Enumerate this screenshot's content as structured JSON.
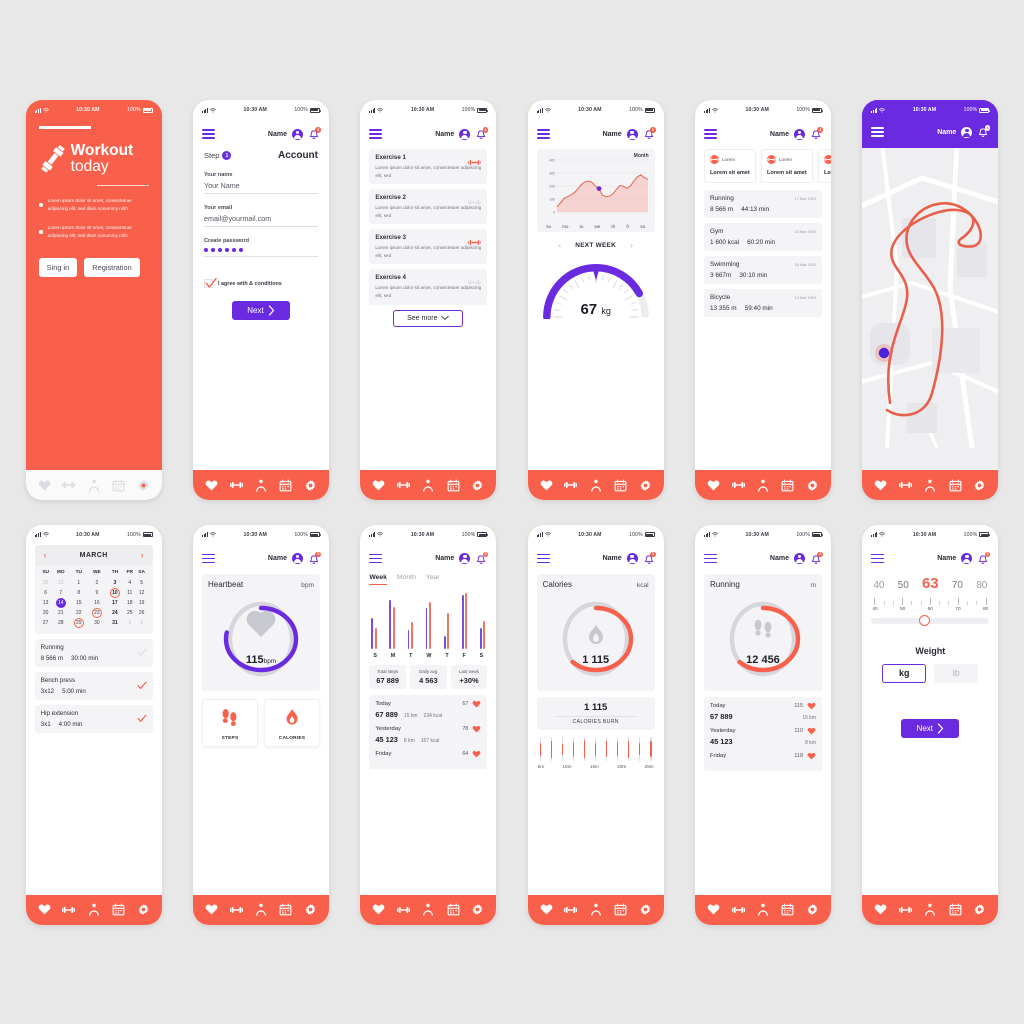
{
  "theme": {
    "red": "#f9604b",
    "purple": "#6a2ae0",
    "bar_purple": "#7b4ce0",
    "bar_red": "#ea7a68",
    "grey_track": "#cfcfd6"
  },
  "statusbar": {
    "time": "10:30 AM",
    "battery": "100%"
  },
  "nav": {
    "items": [
      "heart-icon",
      "dumbbell-icon",
      "person-icon",
      "calendar-icon",
      "gear-icon"
    ]
  },
  "header": {
    "name": "Name",
    "badge": "3"
  },
  "screens": {
    "onboarding": {
      "title_bold": "Workout",
      "title_light": "today",
      "bullets": [
        "Lorem ipsum dolor sit amet, consectetuer adipiscing elit, sed diam nonummy nibh",
        "Lorem ipsum dolor sit amet, consectetuer adipiscing elit, sed diam nonummy nibh"
      ],
      "signin": "Sing in",
      "registration": "Registration"
    },
    "account": {
      "step_label": "Step",
      "step_number": "1",
      "title": "Account",
      "fields": [
        {
          "label": "Your name",
          "value": "Your Name"
        },
        {
          "label": "Your email",
          "value": "email@yourmail.com"
        },
        {
          "label": "Create password",
          "value": "••••••"
        }
      ],
      "agree": "I agree with & conditions",
      "next": "Next"
    },
    "exercises": {
      "items": [
        {
          "title": "Exercise 1",
          "desc": "Lorem ipsum dolor sit amet, consectetuer adipiscing elit, sed",
          "active": true
        },
        {
          "title": "Exercise 2",
          "desc": "Lorem ipsum dolor sit amet, consectetuer adipiscing elit, sed",
          "active": false
        },
        {
          "title": "Exercise 3",
          "desc": "Lorem ipsum dolor sit amet, consectetuer adipiscing elit, sed",
          "active": true
        },
        {
          "title": "Exercise 4",
          "desc": "Lorem ipsum dolor sit amet, consectetuer adipiscing elit, sed",
          "active": false
        }
      ],
      "see_more": "See more"
    },
    "progress": {
      "period": "Month",
      "next_week": "NEXT WEEK",
      "weight_value": "67",
      "weight_unit": "kg"
    },
    "activity": {
      "cards": [
        {
          "tag": "Lorem",
          "body": "Lorem sit amet"
        },
        {
          "tag": "Lorem",
          "body": "Lorem sit amet"
        },
        {
          "tag": "Lorem",
          "body": "Lorem sit amet"
        }
      ],
      "rows": [
        {
          "name": "Running",
          "date": "17 Mar 2019",
          "a": "8 566 m",
          "b": "44:13 min"
        },
        {
          "name": "Gym",
          "date": "16 Mar 2019",
          "a": "1 600 kcal",
          "b": "60:20 min"
        },
        {
          "name": "Swimming",
          "date": "15 Mar 2019",
          "a": "3 667m",
          "b": "30:10 min"
        },
        {
          "name": "Bicycle",
          "date": "14 Mar 2019",
          "a": "13 355 m",
          "b": "59:40 min"
        }
      ]
    },
    "calendar": {
      "month": "MARCH",
      "dow": [
        "SU",
        "MO",
        "TU",
        "WE",
        "TH",
        "FR",
        "SA"
      ],
      "workouts": [
        {
          "name": "Running",
          "a": "8 566 m",
          "b": "30:00 min",
          "done": false
        },
        {
          "name": "Bench press",
          "a": "3x12",
          "b": "5:00 min",
          "done": true
        },
        {
          "name": "Hip extension",
          "a": "3x1",
          "b": "4:00 min",
          "done": true
        }
      ]
    },
    "heartbeat": {
      "title": "Heartbeat",
      "unit": "bpm",
      "value": "115",
      "cards": [
        {
          "label": "STEPS",
          "icon": "footprints-icon"
        },
        {
          "label": "CALORIES",
          "icon": "flame-icon"
        }
      ]
    },
    "steps": {
      "tabs": [
        {
          "label": "Week",
          "active": true
        },
        {
          "label": "Month",
          "active": false
        },
        {
          "label": "Year",
          "active": false
        }
      ],
      "stats": [
        {
          "label": "Total steps",
          "value": "67 889"
        },
        {
          "label": "Daily avg",
          "value": "4 563"
        },
        {
          "label": "Last week",
          "value": "+30%"
        }
      ],
      "days": [
        {
          "day": "Today",
          "bpm": "67",
          "steps": "67 889",
          "dist": "15 km",
          "kcal": "234 kcal"
        },
        {
          "day": "Yesterday",
          "bpm": "78",
          "steps": "45 123",
          "dist": "8 km",
          "kcal": "167 kcal"
        },
        {
          "day": "Friday",
          "bpm": "64",
          "steps": "",
          "dist": "",
          "kcal": ""
        }
      ]
    },
    "calories": {
      "title": "Calories",
      "unit": "kcal",
      "value": "1 115",
      "burn_value": "1 115",
      "burn_label": "CALORIES BURN",
      "time_labels": [
        "5m",
        "10m",
        "15m",
        "20m",
        "25m"
      ]
    },
    "running": {
      "title": "Running",
      "unit": "m",
      "value": "12 456",
      "days": [
        {
          "day": "Today",
          "bpm": "115",
          "steps": "67 889",
          "dist": "15 km"
        },
        {
          "day": "Yesterday",
          "bpm": "110",
          "steps": "45 123",
          "dist": "8 km"
        },
        {
          "day": "Friday",
          "bpm": "118",
          "steps": "",
          "dist": ""
        }
      ]
    },
    "weight": {
      "scale": [
        "40",
        "50",
        "63",
        "70",
        "80"
      ],
      "current_index": 2,
      "tick_labels": [
        "40",
        "50",
        "60",
        "70",
        "80"
      ],
      "label": "Weight",
      "units": [
        {
          "label": "kg",
          "selected": true
        },
        {
          "label": "lb",
          "selected": false
        }
      ],
      "next": "Next"
    }
  },
  "chart_data": [
    {
      "type": "area",
      "title": "Month",
      "xlabel": "",
      "ylabel": "",
      "categories": [
        "su",
        "mo",
        "tu",
        "we",
        "th",
        "fr",
        "sa"
      ],
      "ylim": [
        0,
        400
      ],
      "yticks": [
        0,
        100,
        200,
        300,
        400
      ],
      "grid": true,
      "x": [
        0,
        4,
        8,
        12,
        16,
        20,
        24,
        28,
        32,
        36,
        40,
        44,
        48,
        52,
        56,
        60,
        64,
        68,
        72,
        76,
        80,
        84,
        88,
        92,
        96,
        100
      ],
      "values": [
        40,
        70,
        105,
        118,
        132,
        150,
        178,
        212,
        232,
        238,
        228,
        200,
        178,
        130,
        118,
        122,
        140,
        175,
        205,
        198,
        182,
        200,
        240,
        272,
        285,
        262,
        252
      ],
      "marker": {
        "x": "we",
        "y": 180,
        "color": "#6a2ae0"
      }
    },
    {
      "type": "bar",
      "title": "Week steps",
      "categories": [
        "S",
        "M",
        "T",
        "W",
        "T",
        "F",
        "S"
      ],
      "series": [
        {
          "name": "purple",
          "values": [
            33,
            52,
            20,
            43,
            13,
            57,
            22
          ]
        },
        {
          "name": "red",
          "values": [
            22,
            44,
            28,
            50,
            38,
            60,
            30
          ]
        }
      ],
      "ylim": [
        0,
        60
      ],
      "grid": false
    },
    {
      "type": "bar",
      "title": "Calories time bars",
      "categories": [
        "5m",
        "10m",
        "15m",
        "20m",
        "25m"
      ],
      "values": [
        55,
        70,
        48,
        62,
        75,
        52,
        68,
        58,
        72,
        50,
        65
      ],
      "ylim": [
        0,
        100
      ],
      "grid": false
    },
    {
      "type": "gauge",
      "title": "Weight gauge",
      "value": 67,
      "unit": "kg",
      "min": 0,
      "max": 100,
      "arc_percent": 42
    },
    {
      "type": "gauge",
      "title": "Heartbeat",
      "value": 115,
      "unit": "bpm",
      "arc_percent": 78
    },
    {
      "type": "gauge",
      "title": "Calories",
      "value": 1115,
      "unit": "kcal",
      "arc_percent": 62
    },
    {
      "type": "gauge",
      "title": "Running",
      "value": 12456,
      "unit": "m",
      "arc_percent": 62
    }
  ]
}
